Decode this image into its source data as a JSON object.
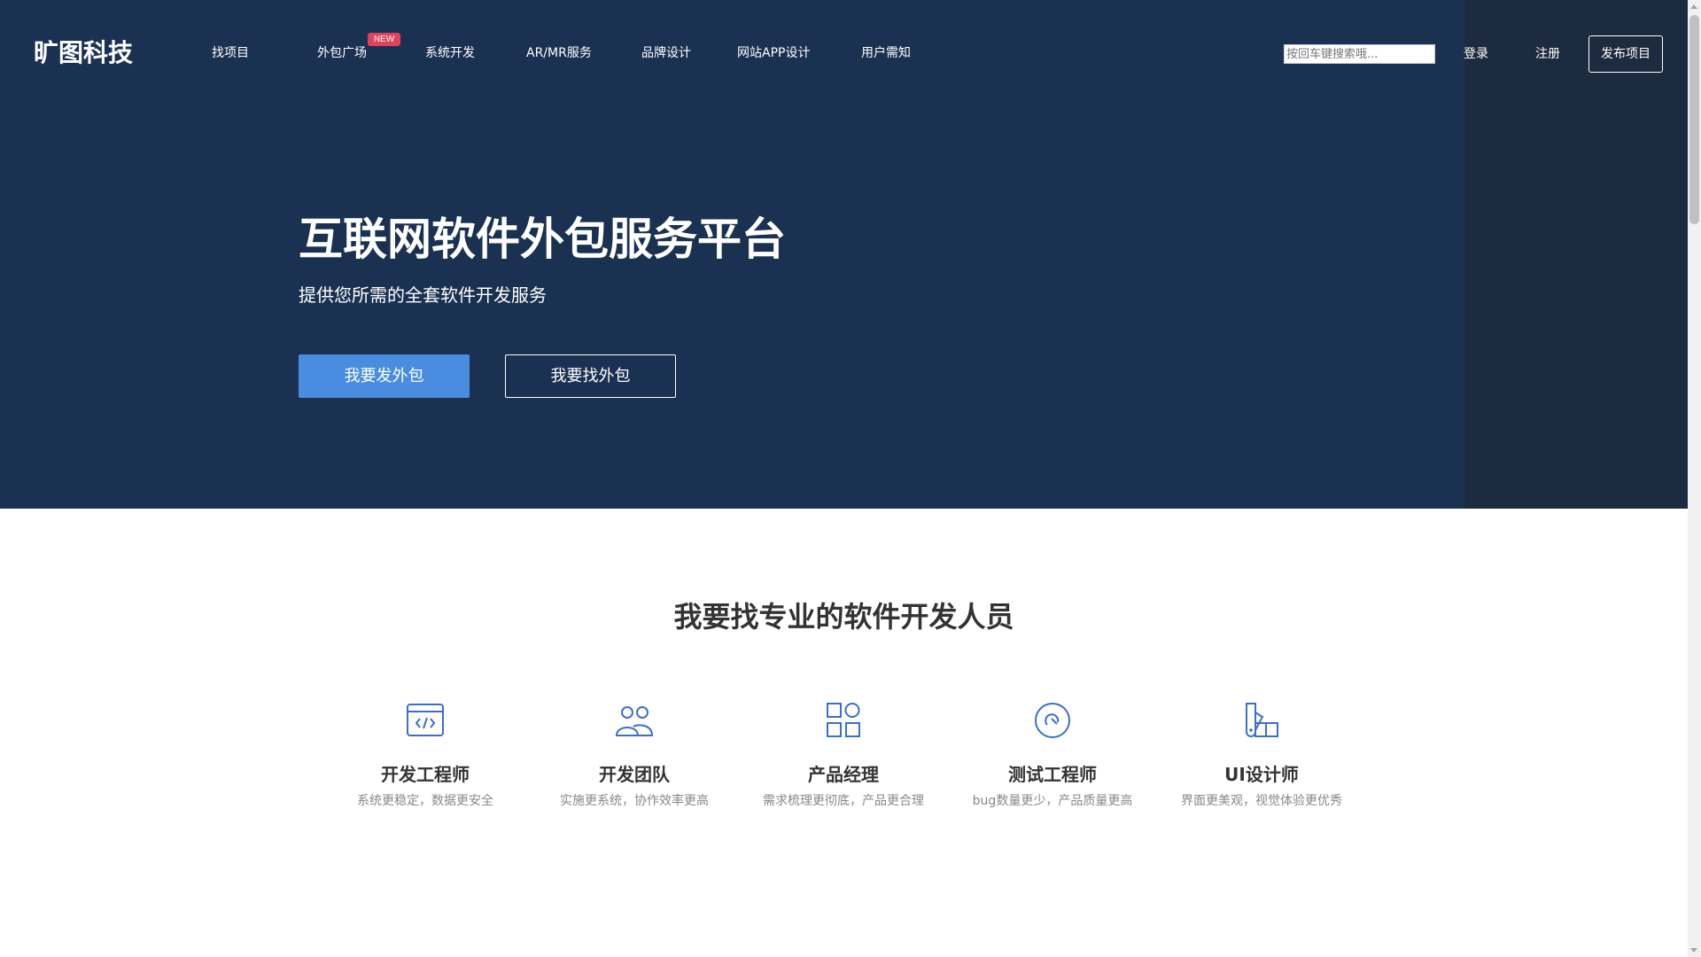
{
  "header": {
    "logo_text": "旷图科技",
    "nav": [
      {
        "label": "找项目"
      },
      {
        "label": "外包广场",
        "badge": "NEW"
      },
      {
        "label": "系统开发"
      },
      {
        "label": "AR/MR服务"
      },
      {
        "label": "品牌设计"
      },
      {
        "label": "网站APP设计"
      },
      {
        "label": "用户需知"
      }
    ],
    "search_placeholder": "按回车键搜索哦...",
    "login_label": "登录",
    "register_label": "注册",
    "publish_label": "发布项目"
  },
  "hero": {
    "title": "互联网软件外包服务平台",
    "subtitle": "提供您所需的全套软件开发服务",
    "primary_button": "我要发外包",
    "secondary_button": "我要找外包"
  },
  "section": {
    "title": "我要找专业的软件开发人员",
    "cards": [
      {
        "icon": "code-window-icon",
        "name": "开发工程师",
        "desc": "系统更稳定，数据更安全"
      },
      {
        "icon": "team-icon",
        "name": "开发团队",
        "desc": "实施更系统，协作效率更高"
      },
      {
        "icon": "grid-apps-icon",
        "name": "产品经理",
        "desc": "需求梳理更彻底，产品更合理"
      },
      {
        "icon": "test-gauge-icon",
        "name": "测试工程师",
        "desc": "bug数量更少，产品质量更高"
      },
      {
        "icon": "design-tools-icon",
        "name": "UI设计师",
        "desc": "界面更美观，视觉体验更优秀"
      }
    ]
  },
  "colors": {
    "hero_bg": "#1b3152",
    "accent": "#4a8de0",
    "icon_color": "#3a6fd0",
    "badge": "#e0415c"
  }
}
